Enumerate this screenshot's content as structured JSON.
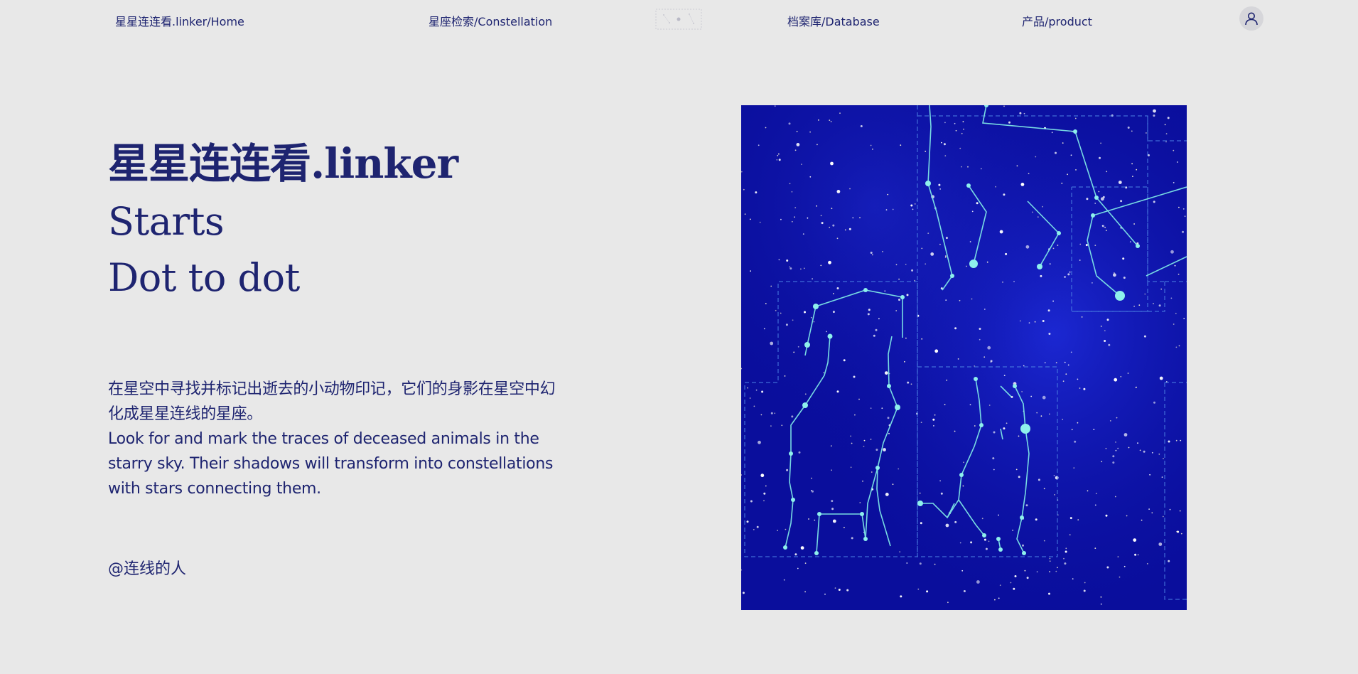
{
  "nav": {
    "items": [
      {
        "label": "星星连连看.linker/Home"
      },
      {
        "label": "星座检索/Constellation"
      },
      {
        "label": "档案库/Database"
      },
      {
        "label": "产品/product"
      }
    ],
    "logo_icon": "constellation-logo-icon",
    "avatar_icon": "user-icon"
  },
  "hero": {
    "title": "星星连连看.linker",
    "line1": "Starts",
    "line2": "Dot to dot"
  },
  "description": {
    "zh": "在星空中寻找并标记出逝去的小动物印记，它们的身影在星空中幻化成星星连线的星座。",
    "en": "Look for and mark the traces of deceased animals in the starry sky. Their shadows will transform into constellations with stars connecting them."
  },
  "author": "@连线的人",
  "colors": {
    "background": "#e8e8e8",
    "text": "#1e2470",
    "sky": "#0b0fa0",
    "constellation": "#7ee6e6"
  }
}
